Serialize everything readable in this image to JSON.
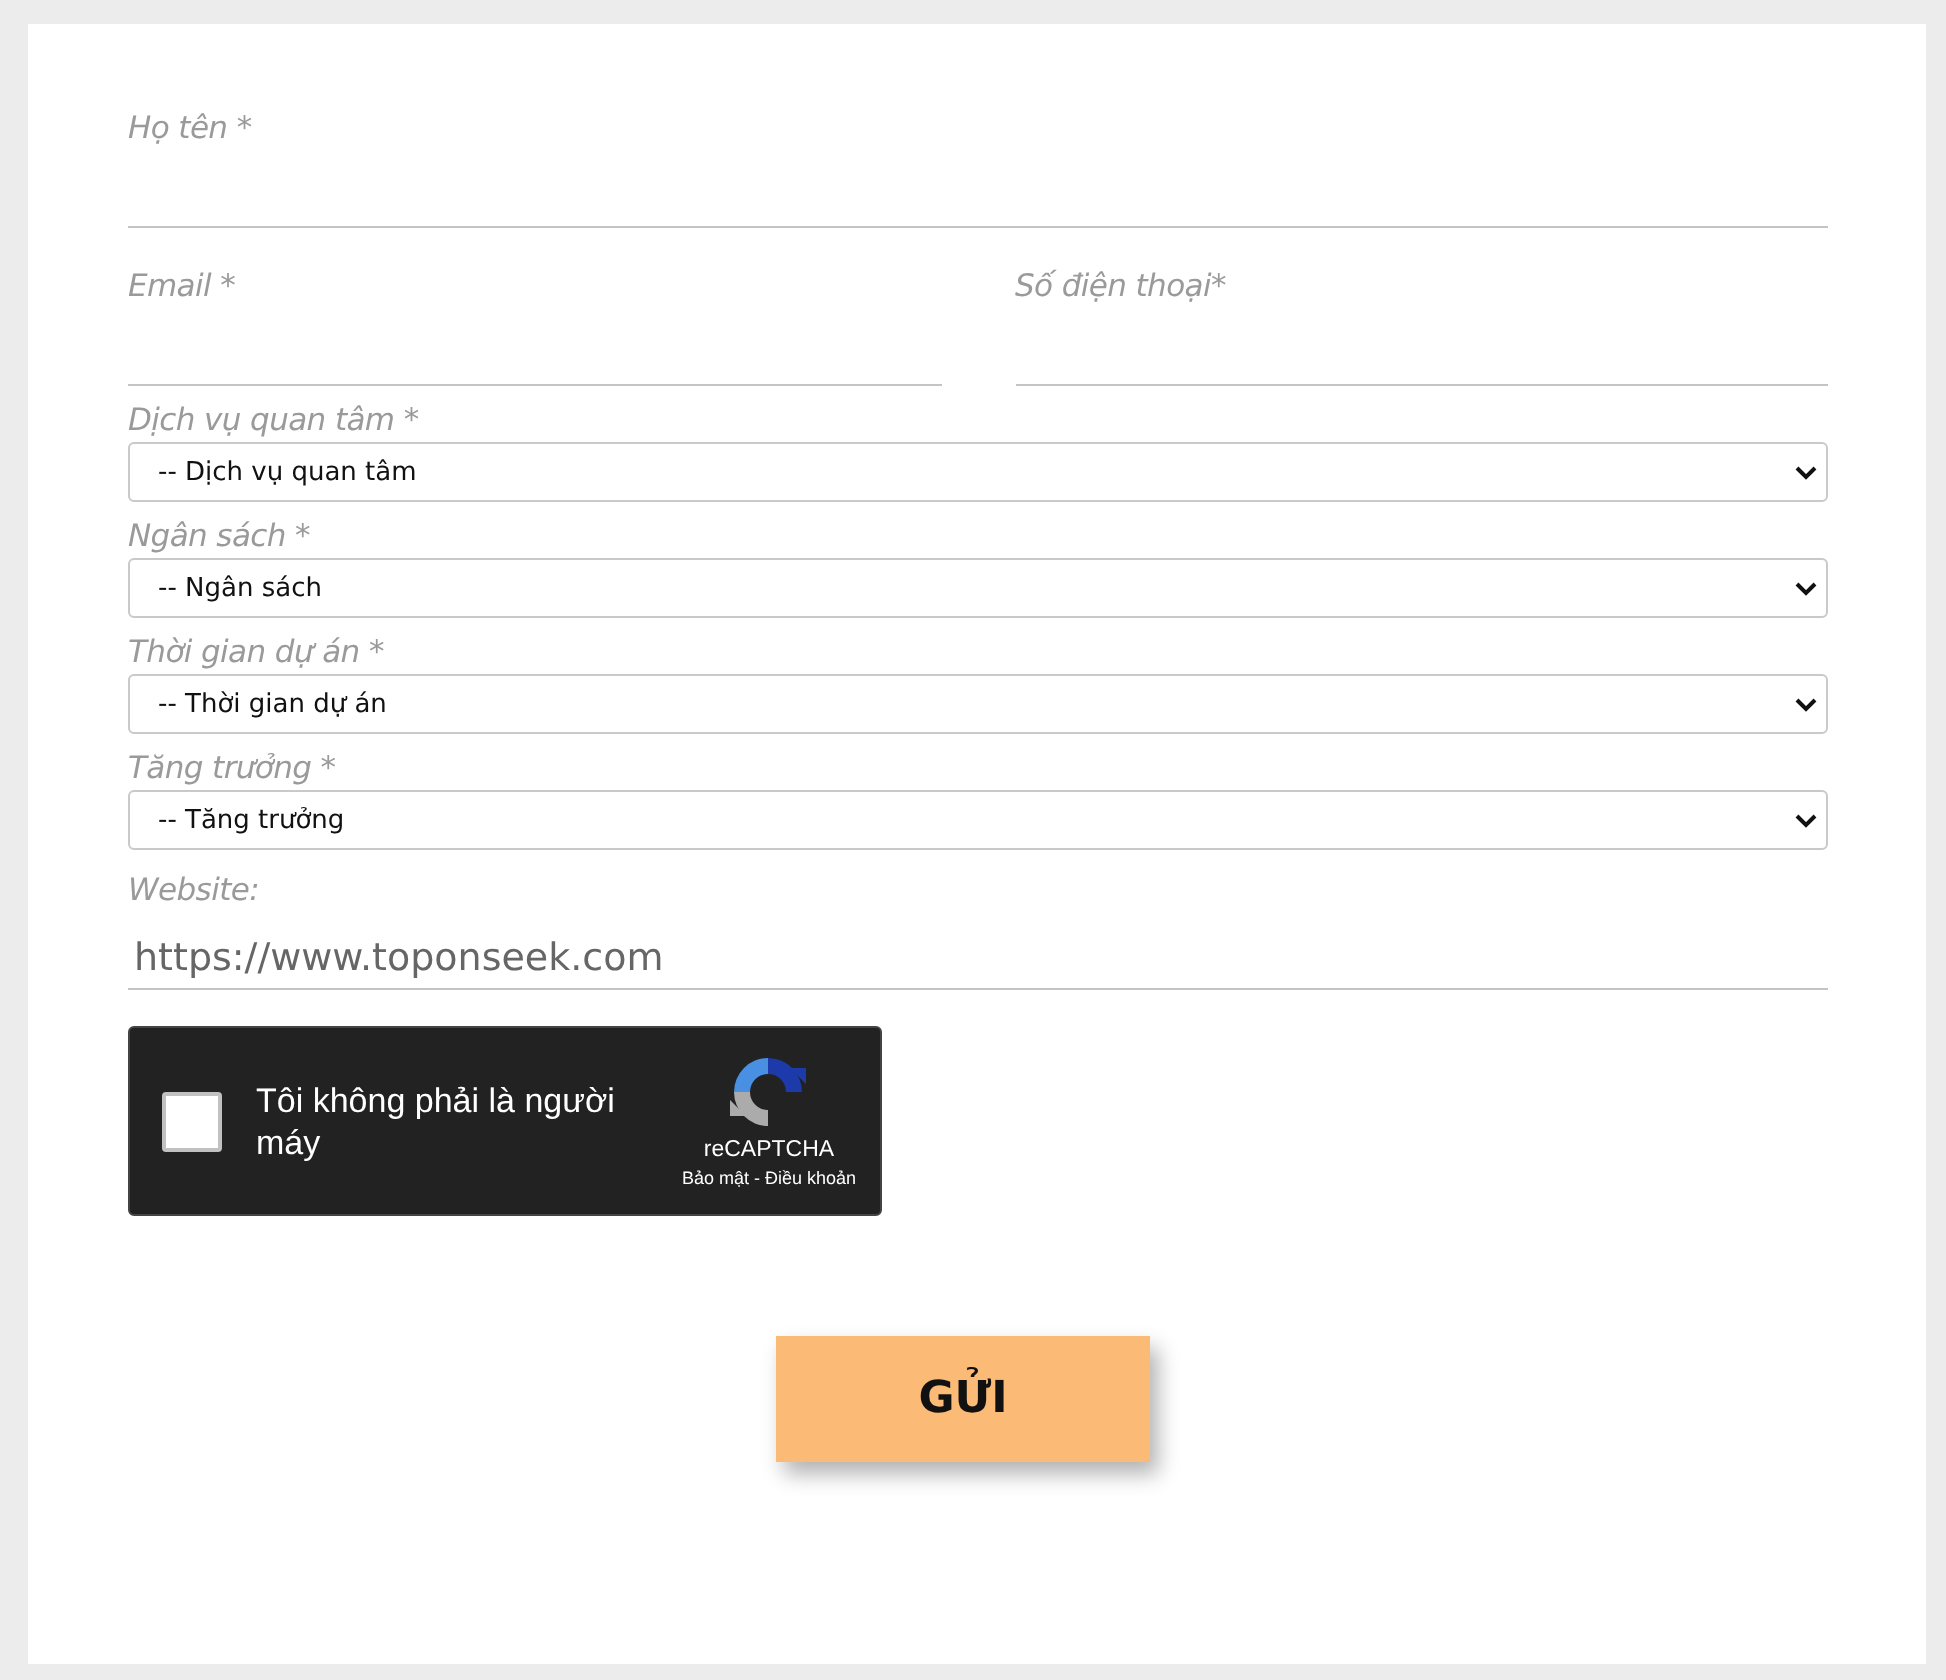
{
  "name_field": {
    "label": "Họ tên *"
  },
  "contact_row": [
    {
      "label": "Email *"
    },
    {
      "label": "Số điện thoại*"
    }
  ],
  "selects": [
    {
      "label": "Dịch vụ quan tâm *",
      "value": "-- Dịch vụ quan tâm"
    },
    {
      "label": "Ngân sách *",
      "value": "-- Ngân sách"
    },
    {
      "label": "Thời gian dự án *",
      "value": "-- Thời gian dự án"
    },
    {
      "label": "Tăng trưởng *",
      "value": "-- Tăng trưởng"
    }
  ],
  "website": {
    "label": "Website:",
    "value": "https://www.toponseek.com"
  },
  "captcha": {
    "checked": false,
    "label": "Tôi không phải là người máy",
    "brand": "reCAPTCHA",
    "links": "Bảo mật - Điều khoản"
  },
  "submit": "GỬI"
}
